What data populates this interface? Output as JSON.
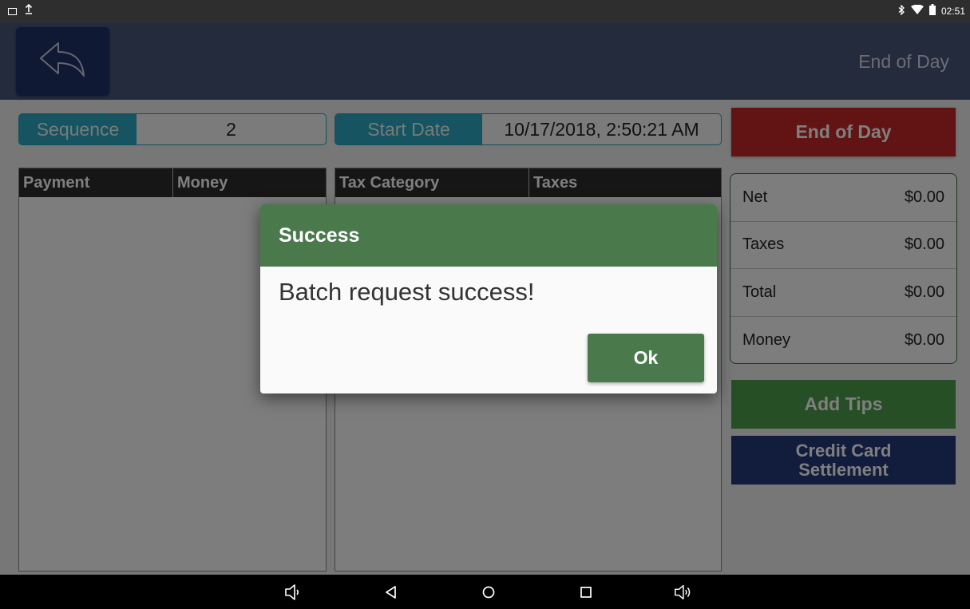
{
  "status_bar": {
    "time": "02:51",
    "left_icons": [
      "image-icon",
      "upload-icon"
    ],
    "right_icons": [
      "bluetooth-icon",
      "wifi-icon",
      "battery-icon"
    ]
  },
  "header": {
    "title": "End of Day",
    "back_icon": "reply-arrow-icon"
  },
  "fields": {
    "sequence_label": "Sequence",
    "sequence_value": "2",
    "start_date_label": "Start Date",
    "start_date_value": "10/17/2018, 2:50:21 AM"
  },
  "payment_panel": {
    "columns": [
      "Payment",
      "Money"
    ],
    "rows": []
  },
  "tax_panel": {
    "columns": [
      "Tax Category",
      "Taxes"
    ],
    "rows": []
  },
  "actions": {
    "end_of_day": "End of Day",
    "add_tips": "Add Tips",
    "credit_card_settlement": "Credit Card\nSettlement"
  },
  "totals": [
    {
      "label": "Net",
      "value": "$0.00"
    },
    {
      "label": "Taxes",
      "value": "$0.00"
    },
    {
      "label": "Total",
      "value": "$0.00"
    },
    {
      "label": "Money",
      "value": "$0.00"
    }
  ],
  "dialog": {
    "title": "Success",
    "message": "Batch request success!",
    "ok_label": "Ok"
  },
  "nav_bar": {
    "icons": [
      "volume-down-icon",
      "back-icon",
      "home-icon",
      "recents-icon",
      "volume-up-icon"
    ]
  },
  "colors": {
    "header": "#47577a",
    "back_button": "#1f3366",
    "field_label": "#2aa8c0",
    "end_of_day_button": "#c5282a",
    "add_tips_button": "#4d9e4d",
    "credit_card_button": "#24387a",
    "dialog_accent": "#4a7a4c"
  }
}
